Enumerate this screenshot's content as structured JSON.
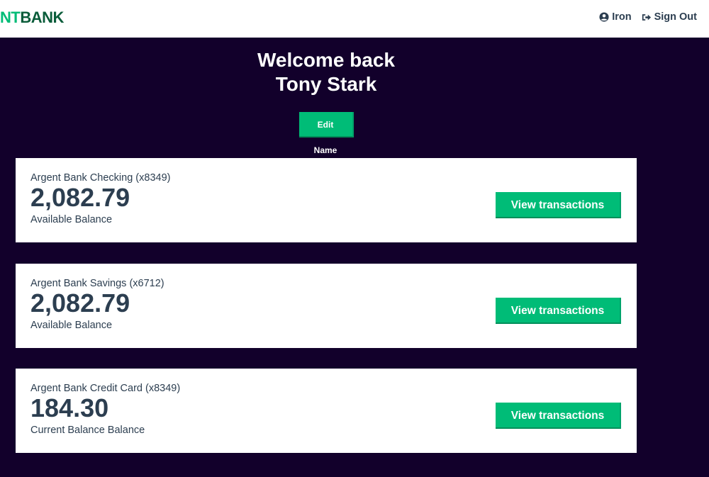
{
  "nav": {
    "logo_part1": "NT",
    "logo_part2": "BANK",
    "user_label": "Iron",
    "signout_label": "Sign Out"
  },
  "header": {
    "line1": "Welcome back",
    "line2": "Tony Stark",
    "edit_label": "Edit Name"
  },
  "accounts": [
    {
      "title": "Argent Bank Checking (x8349)",
      "amount": "2,082.79",
      "description": "Available Balance",
      "button": "View transactions"
    },
    {
      "title": "Argent Bank Savings (x6712)",
      "amount": "2,082.79",
      "description": "Available Balance",
      "button": "View transactions"
    },
    {
      "title": "Argent Bank Credit Card (x8349)",
      "amount": "184.30",
      "description": "Current Balance Balance",
      "button": "View transactions"
    }
  ],
  "colors": {
    "primary_green": "#00bc77",
    "dark_background": "#12002b",
    "text": "#2c3e50"
  }
}
